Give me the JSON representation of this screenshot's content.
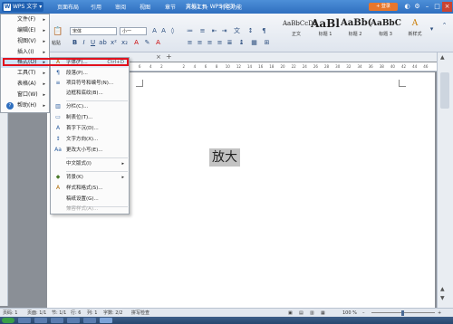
{
  "app": {
    "name": "WPS 文字",
    "doc_title": "文档1 * - WPS 文字",
    "login": "+ 登录"
  },
  "tabs": [
    "开始",
    "页面布局",
    "引用",
    "审阅",
    "视图",
    "章节",
    "开发工具",
    "特色功能"
  ],
  "toolbar": {
    "font_name": "宋体",
    "font_size": "小一",
    "paste": "粘贴"
  },
  "styles": [
    {
      "preview": "AaBbCcDd",
      "name": "正文"
    },
    {
      "preview": "AaBl",
      "name": "标题 1"
    },
    {
      "preview": "AaBb(",
      "name": "标题 2"
    },
    {
      "preview": "AaBbC",
      "name": "标题 3"
    },
    {
      "preview": "A",
      "name": "新样式"
    }
  ],
  "left_menu": [
    {
      "label": "文件(F)",
      "icon": "none"
    },
    {
      "label": "编辑(E)",
      "icon": "none"
    },
    {
      "label": "视图(V)",
      "icon": "none"
    },
    {
      "label": "插入(I)",
      "icon": "none"
    },
    {
      "label": "格式(O)",
      "icon": "none"
    },
    {
      "label": "工具(T)",
      "icon": "none"
    },
    {
      "label": "表格(A)",
      "icon": "none"
    },
    {
      "label": "窗口(W)",
      "icon": "none"
    },
    {
      "label": "帮助(H)",
      "icon": "help-icon"
    }
  ],
  "format_menu": [
    {
      "label": "字体(F)...",
      "shortcut": "Ctrl+D",
      "icon": "A",
      "arrow": ""
    },
    {
      "label": "段落(P)...",
      "shortcut": "",
      "icon": "¶",
      "arrow": ""
    },
    {
      "label": "项目符号和编号(N)...",
      "shortcut": "",
      "icon": "≡",
      "arrow": ""
    },
    {
      "label": "边框和底纹(B)...",
      "shortcut": "",
      "icon": "",
      "arrow": ""
    },
    {
      "label": "分栏(C)...",
      "shortcut": "",
      "icon": "▥",
      "arrow": ""
    },
    {
      "label": "制表位(T)...",
      "shortcut": "",
      "icon": "▭",
      "arrow": ""
    },
    {
      "label": "首字下沉(D)...",
      "shortcut": "",
      "icon": "A",
      "arrow": ""
    },
    {
      "label": "文字方向(X)...",
      "shortcut": "",
      "icon": "↕",
      "arrow": ""
    },
    {
      "label": "更改大小写(E)...",
      "shortcut": "",
      "icon": "Aa",
      "arrow": ""
    },
    {
      "label": "中文版式(I)",
      "shortcut": "",
      "icon": "",
      "arrow": "▸"
    },
    {
      "label": "背景(K)",
      "shortcut": "",
      "icon": "◆",
      "arrow": "▸"
    },
    {
      "label": "样式和格式(S)...",
      "shortcut": "",
      "icon": "A",
      "arrow": ""
    },
    {
      "label": "稿纸设置(G)...",
      "shortcut": "",
      "icon": "",
      "arrow": ""
    },
    {
      "label": "兼容样式(A)...",
      "shortcut": "",
      "icon": "",
      "arrow": ""
    }
  ],
  "ruler_ticks": [
    "6",
    "4",
    "2",
    "",
    "2",
    "4",
    "6",
    "8",
    "10",
    "12",
    "14",
    "16",
    "18",
    "20",
    "22",
    "24",
    "26",
    "28",
    "30",
    "32",
    "34",
    "36",
    "38",
    "40",
    "42",
    "44",
    "46"
  ],
  "document": {
    "text": "放大"
  },
  "status": {
    "page_num": "页码: 1",
    "page": "页面: 1/1",
    "section": "节: 1/1",
    "line": "行: 6",
    "col": "列: 1",
    "words": "字数: 2/2",
    "spell": "拼写检查",
    "zoom": "100 %"
  },
  "colors": {
    "title_bar": "#2f6fbf",
    "accent": "#e8762b",
    "highlight_border": "#e1111d",
    "menu_hover": "#cfe1f7"
  }
}
